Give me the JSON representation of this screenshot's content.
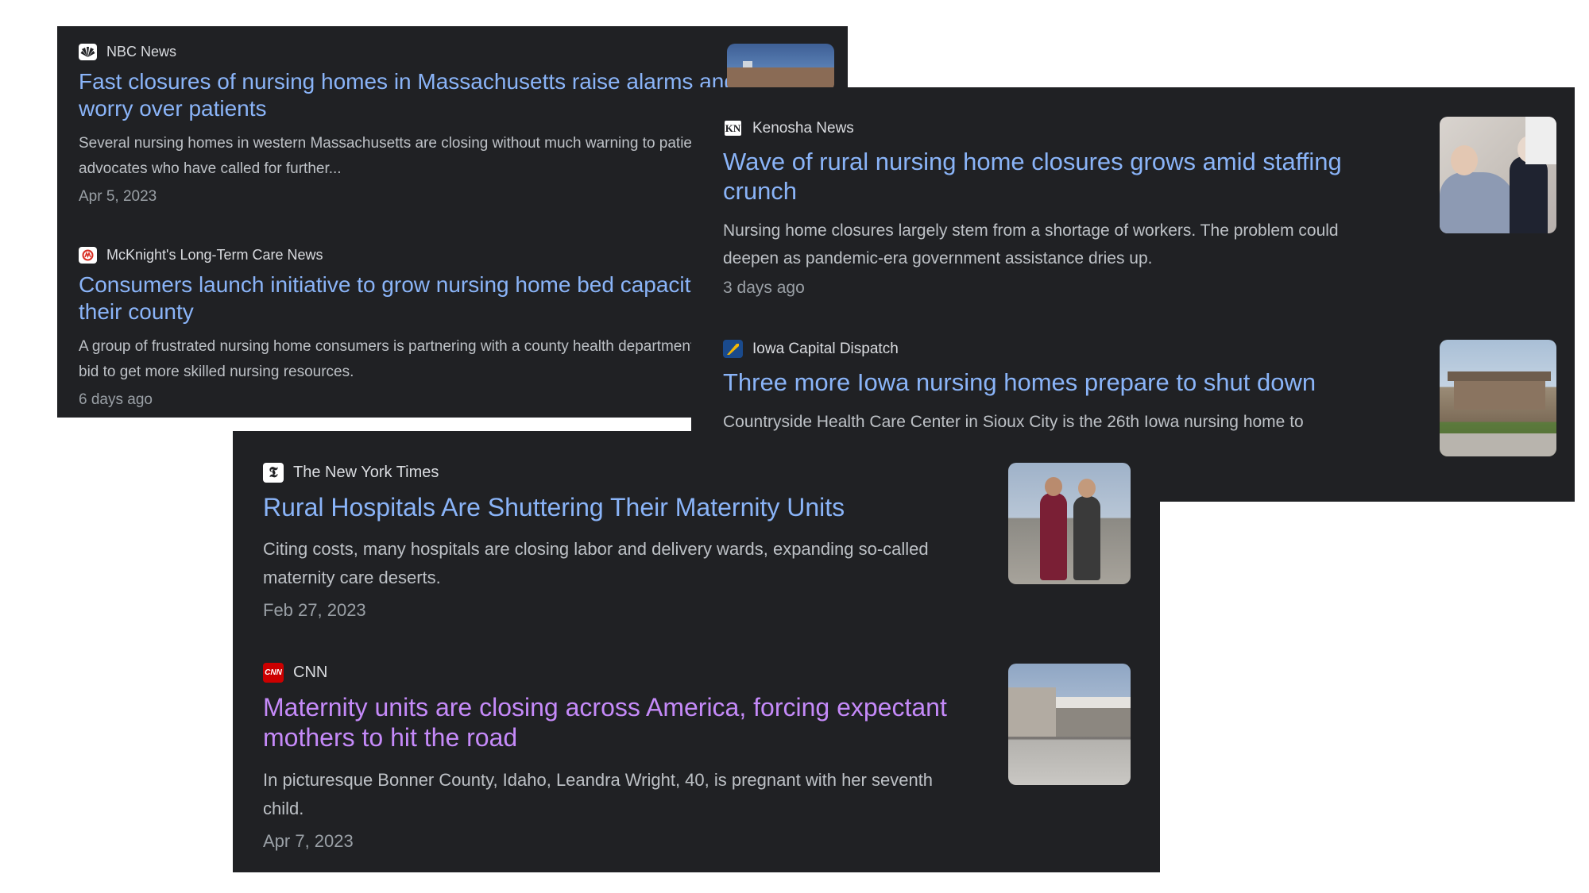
{
  "panel_a": {
    "articles": [
      {
        "source": "NBC News",
        "headline": "Fast closures of nursing homes in Massachusetts raise alarms and worry over patients",
        "snippet": "Several nursing homes in western Massachusetts are closing without much warning to patients, say advocates who have called for further...",
        "date": "Apr 5, 2023",
        "icon": "nbc-peacock-logo"
      },
      {
        "source": "McKnight's Long-Term Care News",
        "headline": "Consumers launch initiative to grow nursing home bed capacity in their county",
        "snippet": "A group of frustrated nursing home consumers is partnering with a county health department in a bid to get more skilled nursing resources.",
        "date": "6 days ago",
        "icon": "mcknights-logo"
      }
    ]
  },
  "panel_b": {
    "articles": [
      {
        "source": "Kenosha News",
        "logo_text": "KN",
        "headline": "Wave of rural nursing home closures grows amid staffing crunch",
        "snippet": "Nursing home closures largely stem from a shortage of workers. The problem could deepen as pandemic-era government assistance dries up.",
        "date": "3 days ago",
        "icon": "kenosha-news-logo"
      },
      {
        "source": "Iowa Capital Dispatch",
        "headline": "Three more Iowa nursing homes prepare to shut down",
        "snippet": "Countryside Health Care Center in Sioux City is the 26th Iowa nursing home to",
        "icon": "iowa-capital-dispatch-logo"
      }
    ]
  },
  "panel_c": {
    "articles": [
      {
        "source": "The New York Times",
        "logo_text": "𝕿",
        "headline": "Rural Hospitals Are Shuttering Their Maternity Units",
        "snippet": "Citing costs, many hospitals are closing labor and delivery wards, expanding so-called maternity care deserts.",
        "date": "Feb 27, 2023",
        "icon": "nyt-logo"
      },
      {
        "source": "CNN",
        "logo_text": "CNN",
        "headline": "Maternity units are closing across America, forcing expectant mothers to hit the road",
        "snippet": "In picturesque Bonner County, Idaho, Leandra Wright, 40, is pregnant with her seventh child.",
        "date": "Apr 7, 2023",
        "icon": "cnn-logo"
      }
    ]
  },
  "colors": {
    "panel_bg": "#202124",
    "headline": "#8ab4f8",
    "headline_visited": "#c58af9",
    "snippet": "#bdc1c6",
    "date": "#9aa0a6"
  }
}
